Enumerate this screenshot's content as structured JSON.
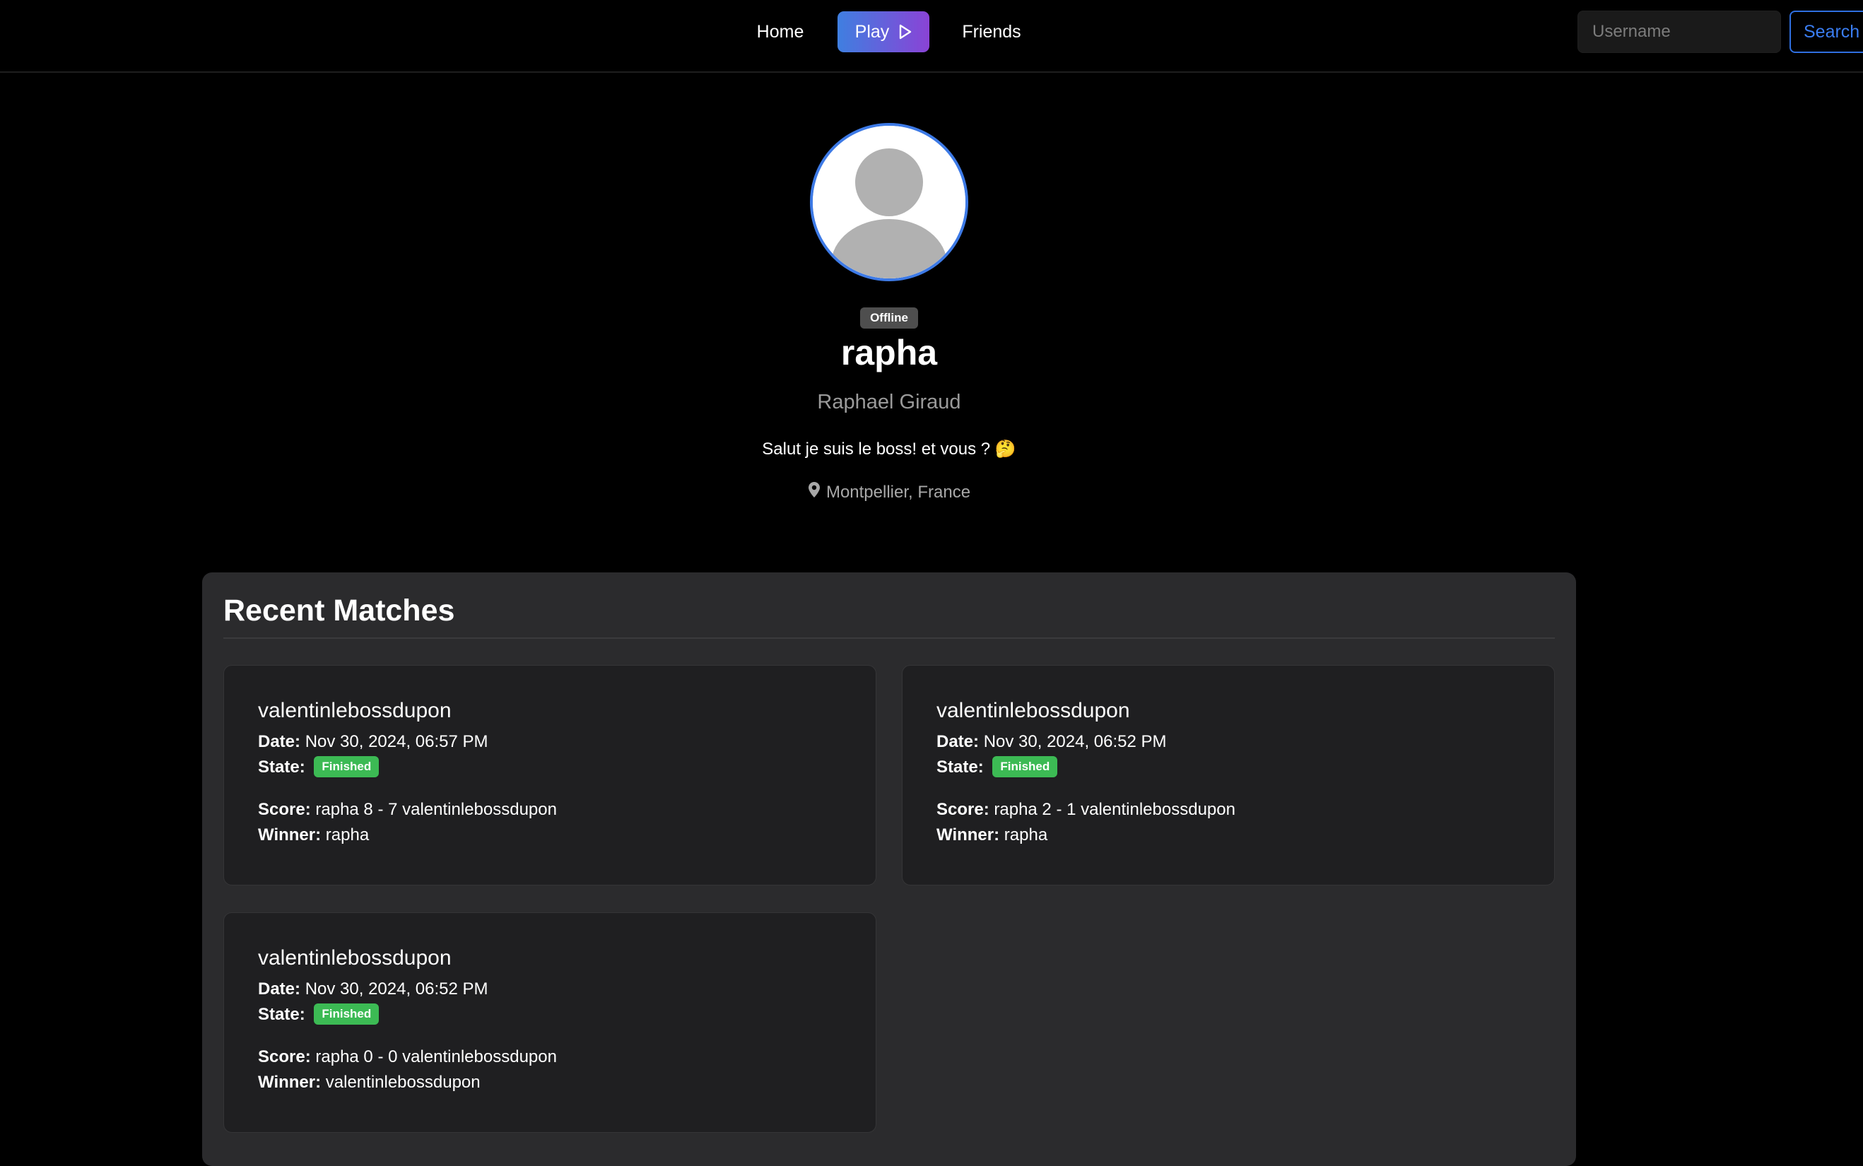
{
  "nav": {
    "home_label": "Home",
    "play_label": "Play",
    "friends_label": "Friends",
    "search_placeholder": "Username",
    "search_button_label": "Search",
    "play_gradient": [
      "#3f7fe0",
      "#8a43d6"
    ]
  },
  "profile": {
    "status": "Offline",
    "username": "rapha",
    "fullname": "Raphael Giraud",
    "bio": "Salut je suis le boss! et vous ? 🤔",
    "location": "Montpellier, France",
    "avatar_icon": "default-user-avatar",
    "avatar_border_color": "#3d7ae6"
  },
  "matches": {
    "title": "Recent Matches",
    "labels": {
      "date": "Date:",
      "state": "State:",
      "score": "Score:",
      "winner": "Winner:"
    },
    "state_badge_color": "#3cba54",
    "items": [
      {
        "opponent": "valentinlebossdupon",
        "date": "Nov 30, 2024, 06:57 PM",
        "state": "Finished",
        "score": "rapha 8 - 7 valentinlebossdupon",
        "winner": "rapha"
      },
      {
        "opponent": "valentinlebossdupon",
        "date": "Nov 30, 2024, 06:52 PM",
        "state": "Finished",
        "score": "rapha 2 - 1 valentinlebossdupon",
        "winner": "rapha"
      },
      {
        "opponent": "valentinlebossdupon",
        "date": "Nov 30, 2024, 06:52 PM",
        "state": "Finished",
        "score": "rapha 0 - 0 valentinlebossdupon",
        "winner": "valentinlebossdupon"
      }
    ]
  }
}
